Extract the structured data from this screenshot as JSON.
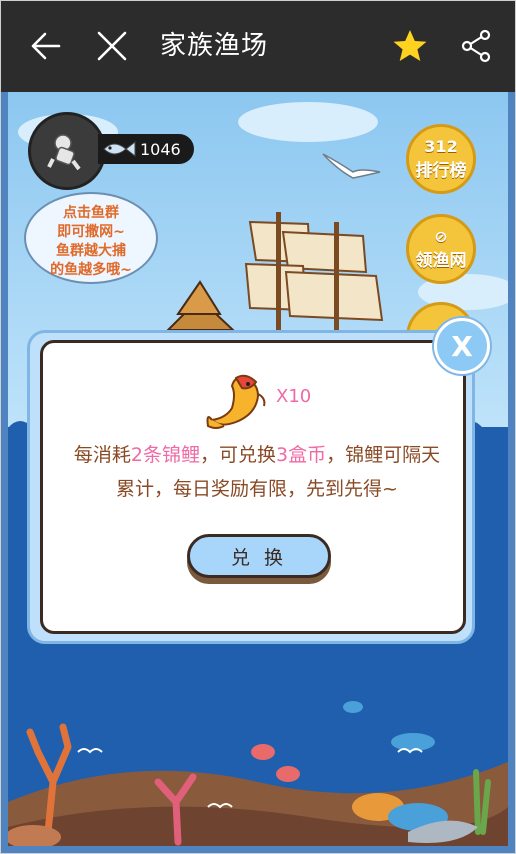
{
  "topbar": {
    "title": "家族渔场",
    "back_icon": "arrow-left-icon",
    "close_icon": "close-icon",
    "favorite_icon": "star-icon",
    "share_icon": "share-icon",
    "star_color": "#ffd21f"
  },
  "player": {
    "fish_count": "1046"
  },
  "hint_bubble": {
    "line1": "点击鱼群",
    "line2": "即可撒网~",
    "line3": "鱼群越大捕",
    "line4": "的鱼越多哦~"
  },
  "side_buttons": {
    "ranking": "排行榜",
    "ranking_icon_text": "312",
    "get_net": "领渔网"
  },
  "dialog": {
    "multiplier": "X10",
    "msg_part1": "每消耗",
    "msg_cost": "2条锦鲤",
    "msg_part2": "，可兑换",
    "msg_reward": "3盒币",
    "msg_part3": "，锦鲤可隔天",
    "msg_line2": "累计，每日奖励有限，先到先得~",
    "exchange_button": "兑 换",
    "close_label": "X",
    "highlight_color": "#ef6aa6",
    "text_color": "#8a4a26"
  }
}
